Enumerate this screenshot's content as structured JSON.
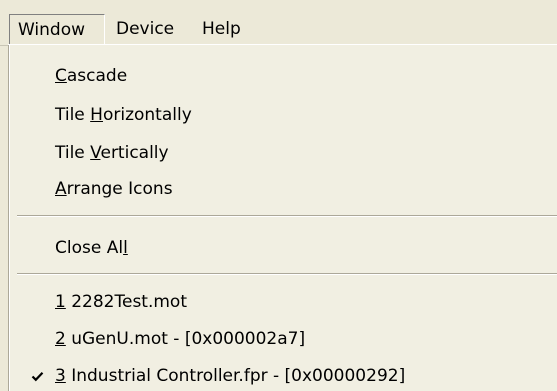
{
  "menubar": {
    "items": [
      {
        "label": "Window",
        "open": true
      },
      {
        "label": "Device"
      },
      {
        "label": "Help"
      }
    ]
  },
  "window_menu": {
    "arrange": [
      {
        "pre": "",
        "mnemonic": "C",
        "post": "ascade"
      },
      {
        "pre": "Tile ",
        "mnemonic": "H",
        "post": "orizontally"
      },
      {
        "pre": "Tile ",
        "mnemonic": "V",
        "post": "ertically"
      },
      {
        "pre": "",
        "mnemonic": "A",
        "post": "rrange Icons"
      }
    ],
    "close_all": {
      "pre": "Close Al",
      "mnemonic": "l",
      "post": ""
    },
    "windows": [
      {
        "mnemonic": "1",
        "post": " 2282Test.mot",
        "checked": false
      },
      {
        "mnemonic": "2",
        "post": " uGenU.mot - [0x000002a7]",
        "checked": false
      },
      {
        "mnemonic": "3",
        "post": " Industrial Controller.fpr - [0x00000292]",
        "checked": true
      }
    ],
    "check_icon": "checkmark-icon"
  }
}
